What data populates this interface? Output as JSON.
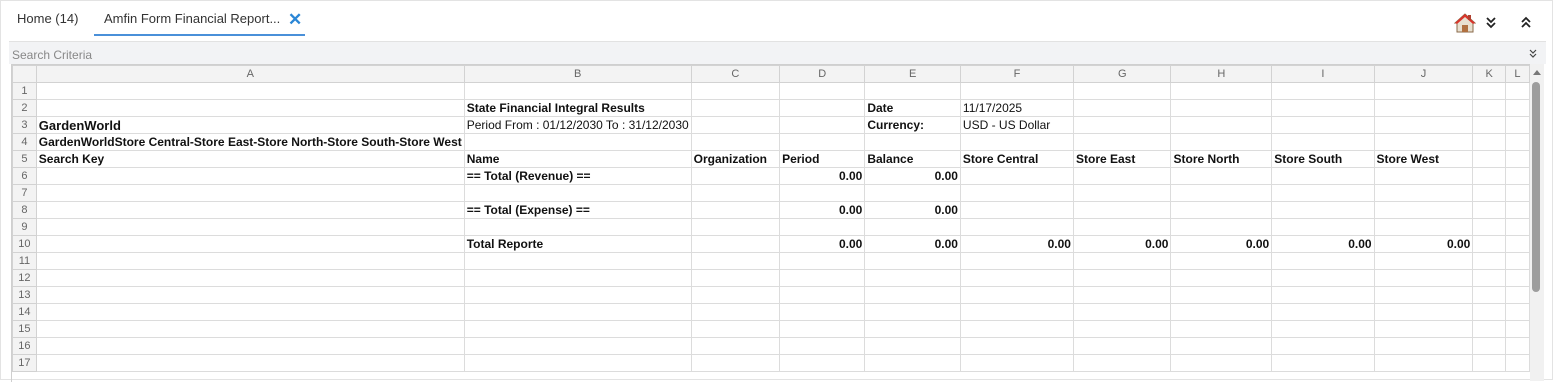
{
  "tabs": [
    {
      "label": "Home (14)"
    },
    {
      "label": "Amfin Form Financial Report..."
    }
  ],
  "toolbar_icons": [
    "home-icon",
    "chevrons-down-icon",
    "chevrons-up-icon",
    "close-icon"
  ],
  "search": {
    "label": "Search Criteria"
  },
  "sheet": {
    "columns": [
      "",
      "A",
      "B",
      "C",
      "D",
      "E",
      "F",
      "G",
      "H",
      "I",
      "J",
      "K",
      "L"
    ],
    "rows": [
      {
        "n": "1",
        "cells": [
          "",
          "",
          "",
          "",
          "",
          "",
          "",
          "",
          "",
          "",
          "",
          ""
        ]
      },
      {
        "n": "2",
        "cells": [
          "",
          "State Financial Integral Results",
          "",
          "",
          "Date",
          "11/17/2025",
          "",
          "",
          "",
          "",
          "",
          ""
        ]
      },
      {
        "n": "3",
        "cells": [
          "GardenWorld",
          "Period From  : 01/12/2030 To  : 31/12/2030",
          "",
          "",
          "Currency:",
          "USD - US Dollar",
          "",
          "",
          "",
          "",
          "",
          ""
        ]
      },
      {
        "n": "4",
        "cells": [
          "GardenWorldStore Central-Store East-Store North-Store South-Store West",
          "",
          "",
          "",
          "",
          "",
          "",
          "",
          "",
          "",
          "",
          ""
        ]
      },
      {
        "n": "5",
        "cells": [
          "Search Key",
          "Name",
          "Organization",
          "Period",
          "Balance",
          "Store Central",
          "Store East",
          "Store North",
          "Store South",
          "Store West",
          "",
          ""
        ]
      },
      {
        "n": "6",
        "cells": [
          "",
          "== Total (Revenue) ==",
          "",
          "0.00",
          "0.00",
          "",
          "",
          "",
          "",
          "",
          "",
          ""
        ]
      },
      {
        "n": "7",
        "cells": [
          "",
          "",
          "",
          "",
          "",
          "",
          "",
          "",
          "",
          "",
          "",
          ""
        ]
      },
      {
        "n": "8",
        "cells": [
          "",
          "== Total (Expense) ==",
          "",
          "0.00",
          "0.00",
          "",
          "",
          "",
          "",
          "",
          "",
          ""
        ]
      },
      {
        "n": "9",
        "cells": [
          "",
          "",
          "",
          "",
          "",
          "",
          "",
          "",
          "",
          "",
          "",
          ""
        ]
      },
      {
        "n": "10",
        "cells": [
          "",
          "Total Reporte",
          "",
          "0.00",
          "0.00",
          "0.00",
          "0.00",
          "0.00",
          "0.00",
          "0.00",
          "",
          ""
        ]
      },
      {
        "n": "11",
        "cells": [
          "",
          "",
          "",
          "",
          "",
          "",
          "",
          "",
          "",
          "",
          "",
          ""
        ]
      },
      {
        "n": "12",
        "cells": [
          "",
          "",
          "",
          "",
          "",
          "",
          "",
          "",
          "",
          "",
          "",
          ""
        ]
      },
      {
        "n": "13",
        "cells": [
          "",
          "",
          "",
          "",
          "",
          "",
          "",
          "",
          "",
          "",
          "",
          ""
        ]
      },
      {
        "n": "14",
        "cells": [
          "",
          "",
          "",
          "",
          "",
          "",
          "",
          "",
          "",
          "",
          "",
          ""
        ]
      },
      {
        "n": "15",
        "cells": [
          "",
          "",
          "",
          "",
          "",
          "",
          "",
          "",
          "",
          "",
          "",
          ""
        ]
      },
      {
        "n": "16",
        "cells": [
          "",
          "",
          "",
          "",
          "",
          "",
          "",
          "",
          "",
          "",
          "",
          ""
        ]
      },
      {
        "n": "17",
        "cells": [
          "",
          "",
          "",
          "",
          "",
          "",
          "",
          "",
          "",
          "",
          "",
          ""
        ]
      }
    ]
  },
  "colors": {
    "accent": "#4a90d9",
    "close": "#2a86d6",
    "header_bg": "#f3f3f3"
  }
}
